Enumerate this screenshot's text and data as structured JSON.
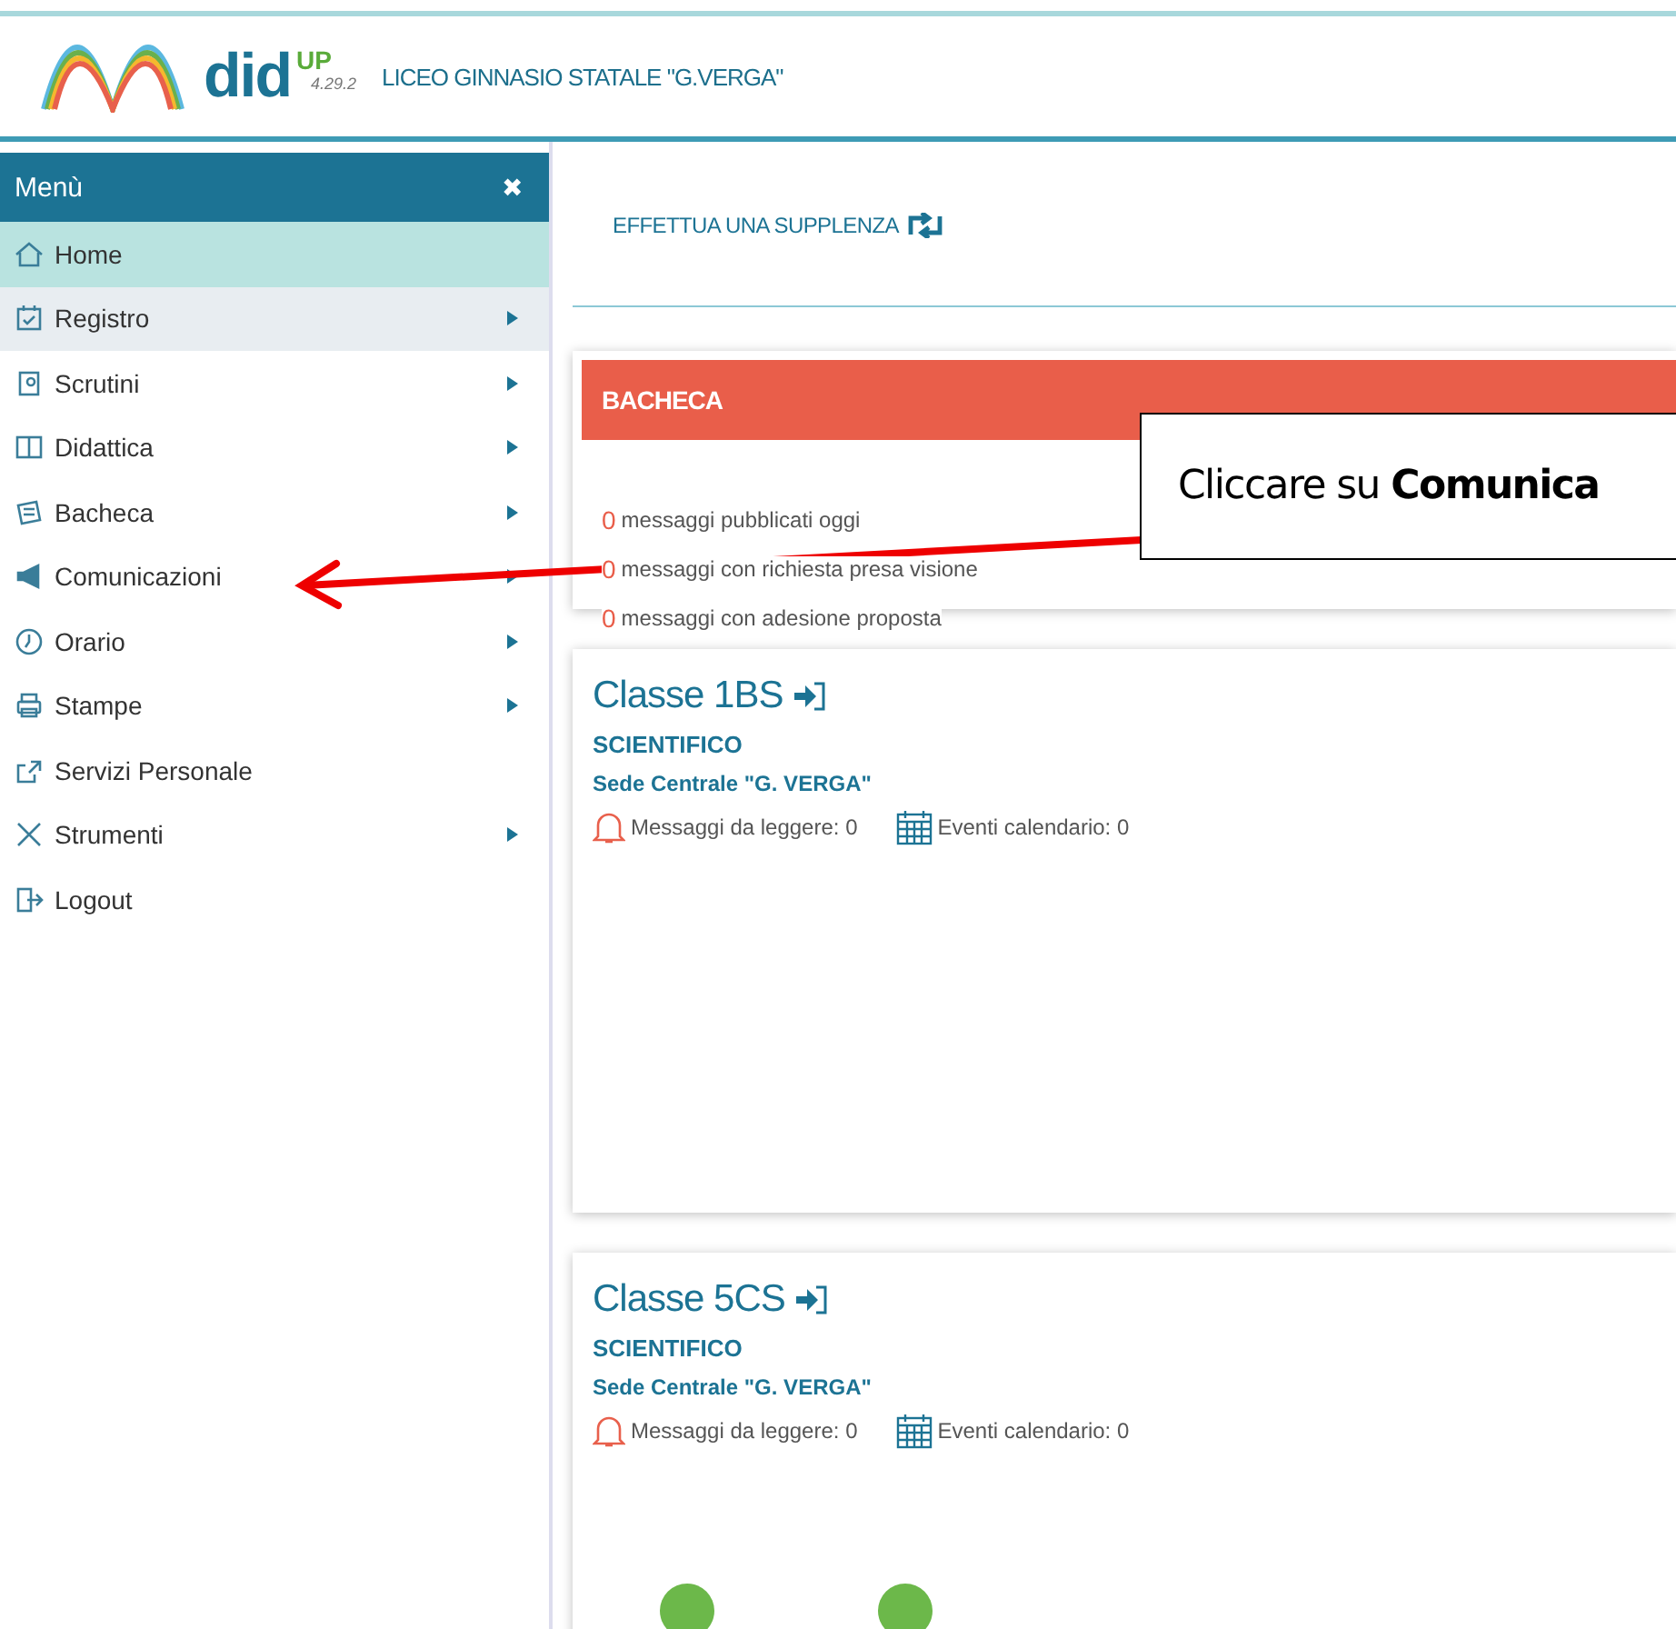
{
  "header": {
    "brand": "did",
    "brand_sup": "UP",
    "version": "4.29.2",
    "school": "LICEO GINNASIO STATALE \"G.VERGA\""
  },
  "sidebar": {
    "title": "Menù",
    "close": "✖",
    "items": [
      {
        "label": "Home",
        "selected": true,
        "hovered": false,
        "submenu": false
      },
      {
        "label": "Registro",
        "selected": false,
        "hovered": true,
        "submenu": true
      },
      {
        "label": "Scrutini",
        "selected": false,
        "hovered": false,
        "submenu": true
      },
      {
        "label": "Didattica",
        "selected": false,
        "hovered": false,
        "submenu": true
      },
      {
        "label": "Bacheca",
        "selected": false,
        "hovered": false,
        "submenu": true
      },
      {
        "label": "Comunicazioni",
        "selected": false,
        "hovered": false,
        "submenu": true
      },
      {
        "label": "Orario",
        "selected": false,
        "hovered": false,
        "submenu": true
      },
      {
        "label": "Stampe",
        "selected": false,
        "hovered": false,
        "submenu": true
      },
      {
        "label": "Servizi Personale",
        "selected": false,
        "hovered": false,
        "submenu": false
      },
      {
        "label": "Strumenti",
        "selected": false,
        "hovered": false,
        "submenu": true
      },
      {
        "label": "Logout",
        "selected": false,
        "hovered": false,
        "submenu": false
      }
    ]
  },
  "substitution_link": "EFFETTUA UNA SUPPLENZA",
  "bacheca": {
    "title": "BACHECA",
    "lines": [
      {
        "count": "0",
        "text": "messaggi pubblicati oggi"
      },
      {
        "count": "0",
        "text": "messaggi con richiesta presa visione"
      },
      {
        "count": "0",
        "text": "messaggi con adesione proposta"
      }
    ]
  },
  "classes": [
    {
      "name": "Classe 1BS",
      "course": "SCIENTIFICO",
      "site": "Sede Centrale \"G. VERGA\"",
      "messages": "Messaggi da leggere: 0",
      "events": "Eventi calendario: 0",
      "status_circles": false
    },
    {
      "name": "Classe 5CS",
      "course": "SCIENTIFICO",
      "site": "Sede Centrale \"G. VERGA\"",
      "messages": "Messaggi da leggere: 0",
      "events": "Eventi calendario: 0",
      "status_circles": true
    }
  ],
  "callout": {
    "text": "Cliccare su **Comunica**"
  }
}
